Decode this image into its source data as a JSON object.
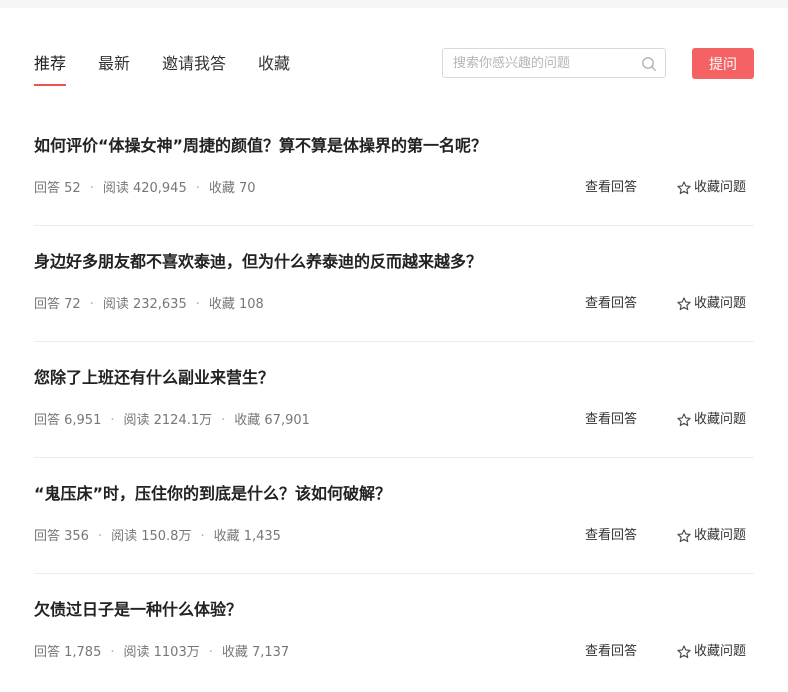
{
  "nav": {
    "tabs": [
      {
        "label": "推荐",
        "active": true
      },
      {
        "label": "最新",
        "active": false
      },
      {
        "label": "邀请我答",
        "active": false
      },
      {
        "label": "收藏",
        "active": false
      }
    ]
  },
  "search": {
    "placeholder": "搜索你感兴趣的问题",
    "icon": "search-icon"
  },
  "ask_button": {
    "label": "提问",
    "color": "#f46264"
  },
  "colors": {
    "accent": "#f0524f"
  },
  "actions": {
    "view_label": "查看回答",
    "favorite_label": "收藏问题",
    "favorite_icon": "star-outline-icon"
  },
  "questions": [
    {
      "title": "如何评价“体操女神”周捷的颜值？算不算是体操界的第一名呢？",
      "answers": "回答 52",
      "reads": "阅读 420,945",
      "favorites": "收藏 70"
    },
    {
      "title": "身边好多朋友都不喜欢泰迪，但为什么养泰迪的反而越来越多？",
      "answers": "回答 72",
      "reads": "阅读 232,635",
      "favorites": "收藏 108"
    },
    {
      "title": "您除了上班还有什么副业来营生？",
      "answers": "回答 6,951",
      "reads": "阅读 2124.1万",
      "favorites": "收藏 67,901"
    },
    {
      "title": "“鬼压床”时，压住你的到底是什么？该如何破解？",
      "answers": "回答 356",
      "reads": "阅读 150.8万",
      "favorites": "收藏 1,435"
    },
    {
      "title": "欠债过日子是一种什么体验？",
      "answers": "回答 1,785",
      "reads": "阅读 1103万",
      "favorites": "收藏 7,137"
    }
  ]
}
